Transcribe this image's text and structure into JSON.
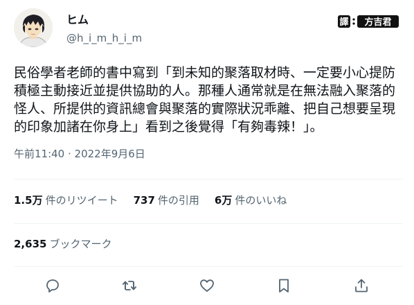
{
  "author": {
    "display_name": "ヒム",
    "handle": "@h_i_m_h_i_m"
  },
  "watermark": {
    "prefix": "譯",
    "name": "方吉君"
  },
  "tweet": {
    "text": "民俗學者老師的書中寫到「到未知的聚落取材時、一定要小心提防積極主動接近並提供協助的人。那種人通常就是在無法融入聚落的怪人、所提供的資訊總會與聚落的實際狀況乖離、把自己想要呈現的印象加諸在你身上」看到之後覺得「有夠毒辣！」。",
    "timestamp": "午前11:40 · 2022年9月6日"
  },
  "stats": {
    "retweets": {
      "value": "1.5万",
      "label": "件のリツイート"
    },
    "quotes": {
      "value": "737",
      "label": "件の引用"
    },
    "likes": {
      "value": "6万",
      "label": "件のいいね"
    },
    "bookmarks": {
      "value": "2,635",
      "label": "ブックマーク"
    }
  },
  "actions": [
    "reply-icon",
    "retweet-icon",
    "like-icon",
    "bookmark-icon",
    "share-icon"
  ],
  "colors": {
    "text": "#0f1419",
    "secondary": "#536471",
    "divider": "#eff3f4"
  }
}
